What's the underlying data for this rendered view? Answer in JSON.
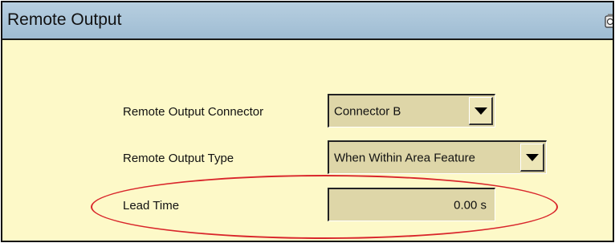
{
  "window": {
    "title": "Remote Output",
    "title_icon": "camera-icon"
  },
  "form": {
    "connector": {
      "label": "Remote Output Connector",
      "value": "Connector B"
    },
    "type": {
      "label": "Remote Output Type",
      "value": "When Within Area Feature"
    },
    "lead_time": {
      "label": "Lead Time",
      "value": "0.00 s"
    }
  },
  "annotation": {
    "color": "#d9262b",
    "shape": "ellipse",
    "target": "lead_time"
  },
  "colors": {
    "background": "#fdf9c8",
    "titlebar": "#a8c3d8",
    "field": "#ded6a8"
  }
}
